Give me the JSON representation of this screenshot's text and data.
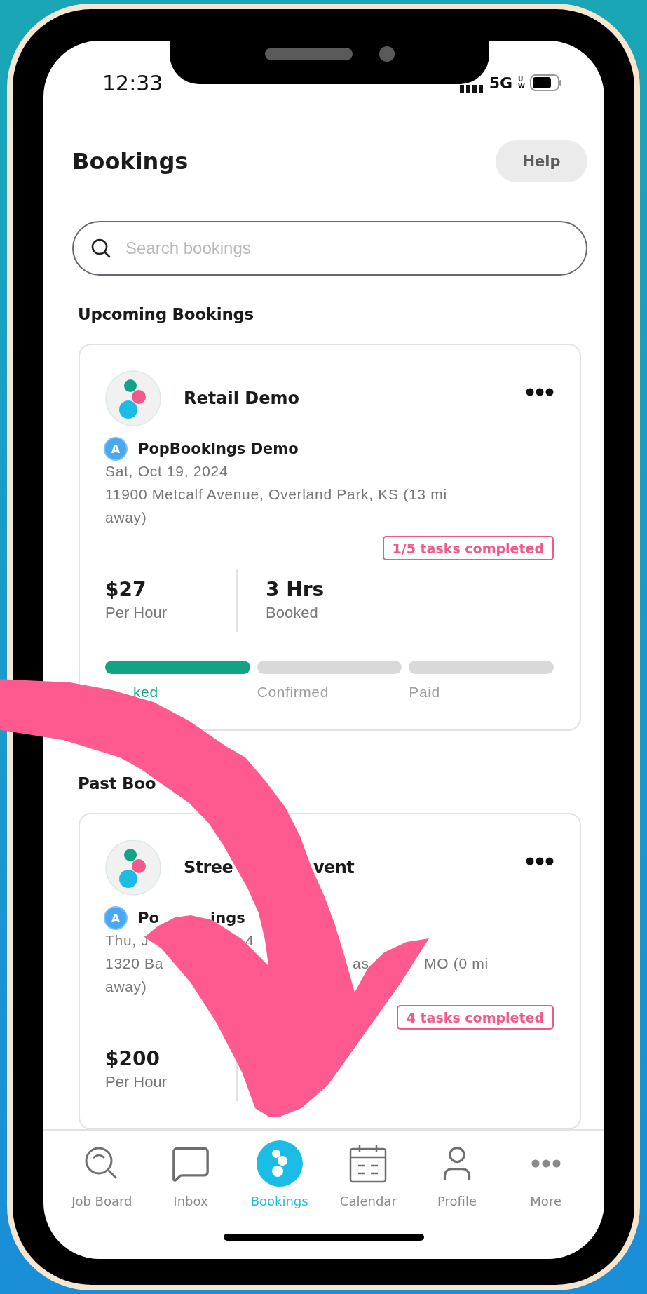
{
  "status_bar": {
    "time": "12:33",
    "network": "5G",
    "network_sub": "UW"
  },
  "header": {
    "title": "Bookings",
    "help_button": "Help"
  },
  "search": {
    "placeholder": "Search bookings"
  },
  "upcoming": {
    "heading": "Upcoming Bookings",
    "bookings": [
      {
        "title": "Retail Demo",
        "badge": "A",
        "organizer": "PopBookings Demo",
        "date": "Sat, Oct 19, 2024",
        "address": "11900 Metcalf Avenue, Overland Park, KS (13 mi away)",
        "tasks": "1/5 tasks completed",
        "rate": "$27",
        "rate_label": "Per Hour",
        "hours": "3 Hrs",
        "hours_label": "Booked",
        "steps": [
          {
            "label": "ked",
            "done": true
          },
          {
            "label": "Confirmed",
            "done": false
          },
          {
            "label": "Paid",
            "done": false
          }
        ]
      }
    ]
  },
  "past": {
    "heading": "Past Boo",
    "booking": {
      "title_parts": [
        "Stree",
        "vent"
      ],
      "badge": "A",
      "organizer_parts": [
        "Po",
        "ings"
      ],
      "date_parts": [
        "Thu, J",
        "4"
      ],
      "address_parts": [
        "1320 Ba",
        "as",
        "MO (0 mi"
      ],
      "address_end": "away)",
      "tasks": "4 tasks completed",
      "rate": "$200",
      "rate_label": "Per Hour"
    }
  },
  "nav": [
    {
      "kind": "jobs",
      "label": "Job Board",
      "selected": false
    },
    {
      "kind": "inbox",
      "label": "Inbox",
      "selected": false
    },
    {
      "kind": "bookings",
      "label": "Bookings",
      "selected": true
    },
    {
      "kind": "calendar",
      "label": "Calendar",
      "selected": false
    },
    {
      "kind": "profile",
      "label": "Profile",
      "selected": false
    },
    {
      "kind": "more",
      "label": "More",
      "selected": false
    }
  ]
}
